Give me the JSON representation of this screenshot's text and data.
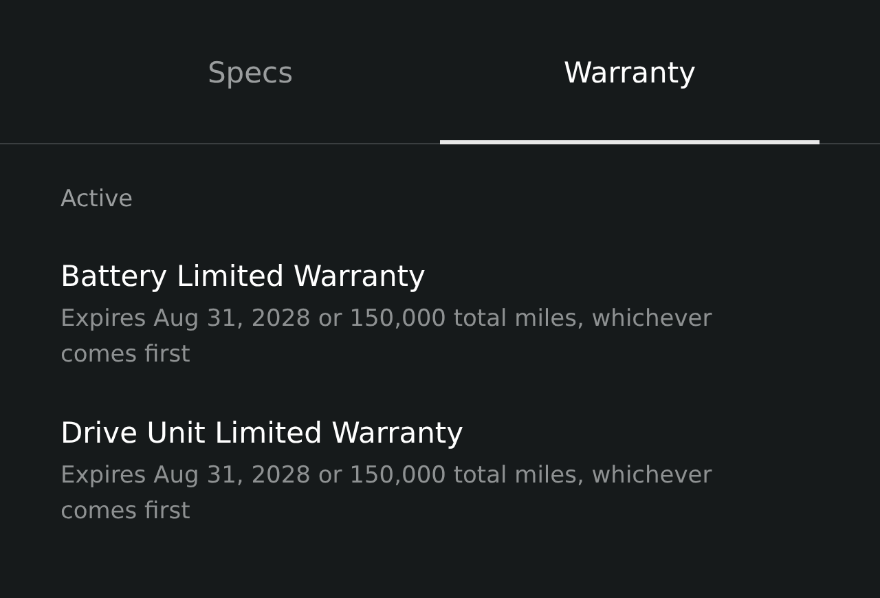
{
  "tabs": [
    {
      "label": "Specs",
      "selected": false
    },
    {
      "label": "Warranty",
      "selected": true
    }
  ],
  "section": {
    "heading": "Active",
    "items": [
      {
        "title": "Battery Limited Warranty",
        "detail": "Expires Aug 31, 2028 or 150,000 total miles, whichever comes first"
      },
      {
        "title": "Drive Unit Limited Warranty",
        "detail": "Expires Aug 31, 2028 or 150,000 total miles, whichever comes first"
      }
    ]
  }
}
